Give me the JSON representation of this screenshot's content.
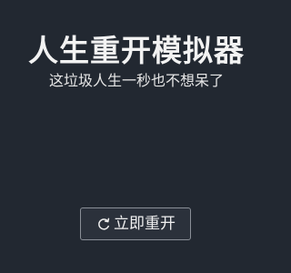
{
  "app": {
    "title": "人生重开模拟器",
    "subtitle": "这垃圾人生一秒也不想呆了"
  },
  "actions": {
    "restart_label": "立即重开",
    "restart_icon": "refresh-icon"
  },
  "colors": {
    "background": "#222831",
    "text": "#eeeeee",
    "button_border": "#8a8f97"
  }
}
